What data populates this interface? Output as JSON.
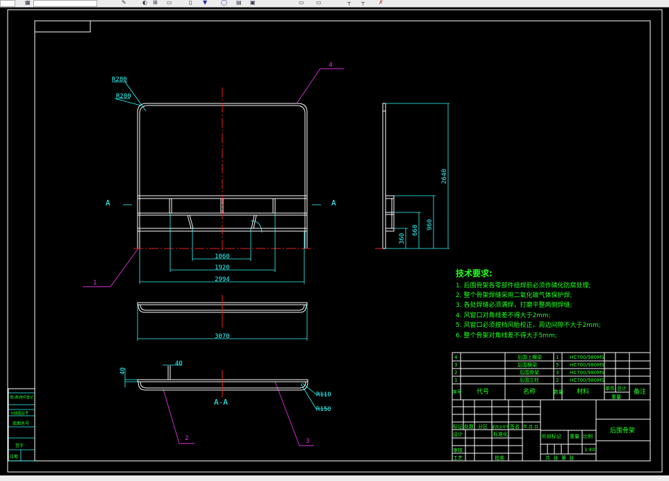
{
  "toolbar": {
    "icons": [
      "layer-icon",
      "properties-icon",
      "match-icon",
      "layer-prev-icon",
      "pan-icon",
      "zoom-icon",
      "zoom-window-icon",
      "zoom-prev-icon",
      "properties-icon",
      "design-center-icon"
    ]
  },
  "colors": {
    "background": "#000000",
    "geometry": "#ffffff",
    "dimension": "#33ffff",
    "centerline": "#ee2222",
    "leader": "#dd33dd",
    "text": "#22ff22"
  },
  "drawing": {
    "radius_outer": "R280",
    "radius_inner": "R200",
    "section_mark_left": "A",
    "section_mark_right": "A",
    "dim_1060": "1060",
    "dim_1920": "1920",
    "dim_2994": "2994",
    "dim_3070": "3070",
    "dim_2640": "2640",
    "dim_960": "960",
    "dim_660": "660",
    "dim_360": "360",
    "dim_40_h": "40",
    "dim_40_v": "40",
    "radius_r110": "R110",
    "radius_r150": "R150",
    "section_label": "A-A",
    "balloons": [
      "1",
      "2",
      "3",
      "4"
    ]
  },
  "tech_requirements": {
    "title": "技术要求:",
    "items": [
      "1. 后围骨架各零部件组焊前必须作磷化防腐处理;",
      "2. 整个骨架焊缝采用二氧化碳气体保护焊;",
      "3. 各处焊缝必须满焊，打磨平整两侧焊缝;",
      "4. 风窗口对角线差不得大于2mm;",
      "5. 风窗口必须按挡风胎校正，周边间隙不大于2mm;",
      "6. 整个骨架对角线差不得大于5mm;"
    ]
  },
  "bom": {
    "rows": [
      {
        "no": "4",
        "code": "",
        "name": "后围上横梁",
        "qty": "1",
        "material": "HC700/980MS"
      },
      {
        "no": "3",
        "code": "",
        "name": "后围横梁",
        "qty": "5",
        "material": "HC700/980MS"
      },
      {
        "no": "2",
        "code": "",
        "name": "后围骨架",
        "qty": "3",
        "material": "HC700/980MS"
      },
      {
        "no": "1",
        "code": "",
        "name": "后围立柱",
        "qty": "2",
        "material": "HC700/980MS"
      }
    ],
    "headers": {
      "no": "序号",
      "code": "代号",
      "name": "名称",
      "qty": "数量",
      "material": "材料",
      "unit": "单件",
      "total": "总计",
      "weight": "重量",
      "remark": "备注"
    }
  },
  "title_block": {
    "rev_headers": [
      "标记",
      "处数",
      "分区",
      "更改文件号",
      "签名",
      "年.月.日"
    ],
    "design": "设计",
    "standard": "标准化",
    "check": "审核",
    "process": "工艺",
    "approve": "批准",
    "stage": "阶段标记",
    "weight": "重量",
    "scale": "比例",
    "scale_value": "1:40",
    "sheets": "共  张  第  张",
    "title": "后围骨架"
  },
  "left_strip": [
    "借(通)用件登记",
    "旧底图总号",
    "底图总号",
    "签字",
    "日期"
  ]
}
